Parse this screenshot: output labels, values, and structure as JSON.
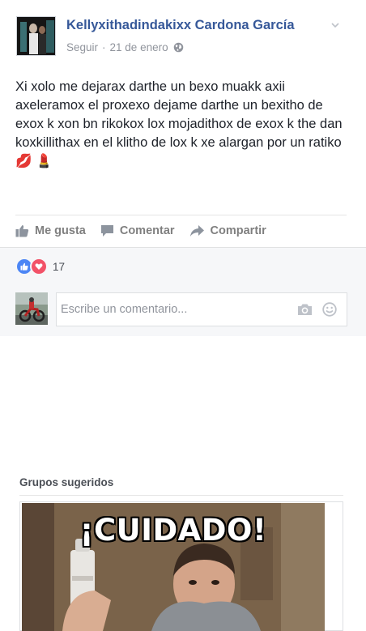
{
  "post": {
    "author": "Kellyxithadindakixx Cardona García",
    "follow_label": "Seguir",
    "separator": "·",
    "date": "21 de enero",
    "privacy_icon": "globe-icon",
    "text": "Xi xolo me dejarax darthe un bexo muakk axii axeleramox el proxexo dejame darthe un bexitho de exox k xon bn rikokox lox mojadithox de exox k the dan koxkillithax en el klitho de lox k xe alargan por un ratiko💋 💄",
    "actions": {
      "like_label": "Me gusta",
      "comment_label": "Comentar",
      "share_label": "Compartir"
    }
  },
  "reactions": {
    "types": [
      "like-icon",
      "love-icon"
    ],
    "count": "17"
  },
  "comment_box": {
    "placeholder": "Escribe un comentario...",
    "icons": [
      "camera-icon",
      "emoji-icon"
    ]
  },
  "suggested_groups": {
    "title": "Grupos sugeridos",
    "card_image_text": "¡CUIDADO!"
  },
  "colors": {
    "link_blue": "#365899",
    "muted_gray": "#90949c",
    "like_blue": "#4c86f5",
    "love_red": "#f25268"
  }
}
